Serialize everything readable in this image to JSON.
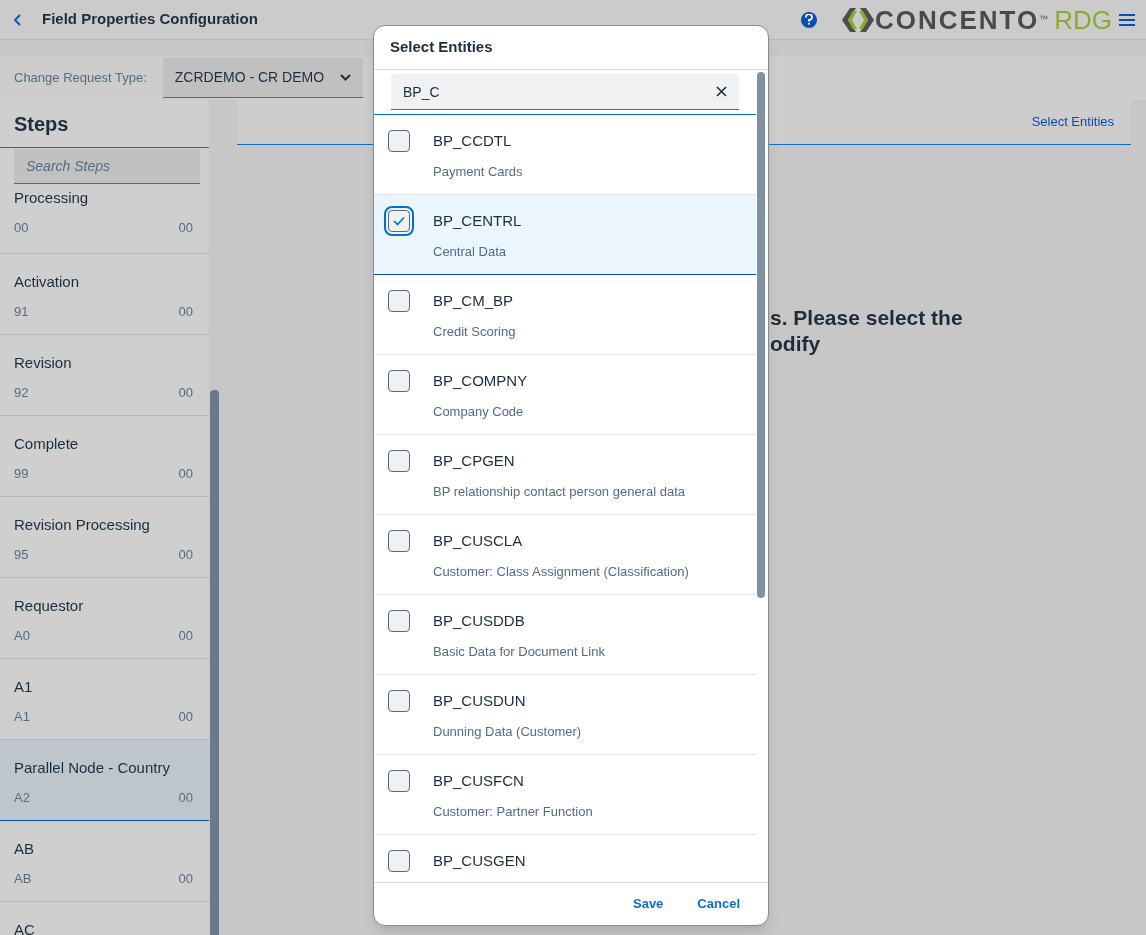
{
  "header": {
    "title": "Field Properties Configuration",
    "logo": {
      "word": "CONCENTO",
      "mark": "™",
      "suffix": "RDG"
    }
  },
  "filter": {
    "label": "Change Request Type:",
    "value": "ZCRDEMO - CR DEMO"
  },
  "sidebar": {
    "title": "Steps",
    "search": {
      "placeholder": "Search Steps"
    },
    "items": [
      {
        "name": "Processing",
        "code": "00",
        "version": "00",
        "selected": false
      },
      {
        "name": "Activation",
        "code": "91",
        "version": "00",
        "selected": false
      },
      {
        "name": "Revision",
        "code": "92",
        "version": "00",
        "selected": false
      },
      {
        "name": "Complete",
        "code": "99",
        "version": "00",
        "selected": false
      },
      {
        "name": "Revision Processing",
        "code": "95",
        "version": "00",
        "selected": false
      },
      {
        "name": "Requestor",
        "code": "A0",
        "version": "00",
        "selected": false
      },
      {
        "name": "A1",
        "code": "A1",
        "version": "00",
        "selected": false
      },
      {
        "name": "Parallel Node - Country",
        "code": "A2",
        "version": "00",
        "selected": true
      },
      {
        "name": "AB",
        "code": "AB",
        "version": "00",
        "selected": false
      },
      {
        "name": "AC",
        "selected": false
      }
    ]
  },
  "main": {
    "link": "Select Entities",
    "message": [
      "s. Please select the",
      "odify"
    ]
  },
  "dialog": {
    "title": "Select Entities",
    "search": {
      "value": "BP_C"
    },
    "items": [
      {
        "code": "BP_CCDTL",
        "description": "Payment Cards",
        "checked": false,
        "selected": false
      },
      {
        "code": "BP_CENTRL",
        "description": "Central Data",
        "checked": true,
        "selected": true
      },
      {
        "code": "BP_CM_BP",
        "description": "Credit Scoring",
        "checked": false,
        "selected": false
      },
      {
        "code": "BP_COMPNY",
        "description": "Company Code",
        "checked": false,
        "selected": false
      },
      {
        "code": "BP_CPGEN",
        "description": "BP relationship contact person general data",
        "checked": false,
        "selected": false
      },
      {
        "code": "BP_CUSCLA",
        "description": "Customer: Class Assignment (Classification)",
        "checked": false,
        "selected": false
      },
      {
        "code": "BP_CUSDDB",
        "description": "Basic Data for Document Link",
        "checked": false,
        "selected": false
      },
      {
        "code": "BP_CUSDUN",
        "description": "Dunning Data (Customer)",
        "checked": false,
        "selected": false
      },
      {
        "code": "BP_CUSFCN",
        "description": "Customer: Partner Function",
        "checked": false,
        "selected": false
      },
      {
        "code": "BP_CUSGEN",
        "checked": false,
        "selected": false
      }
    ],
    "buttons": [
      "Save",
      "Cancel"
    ]
  }
}
